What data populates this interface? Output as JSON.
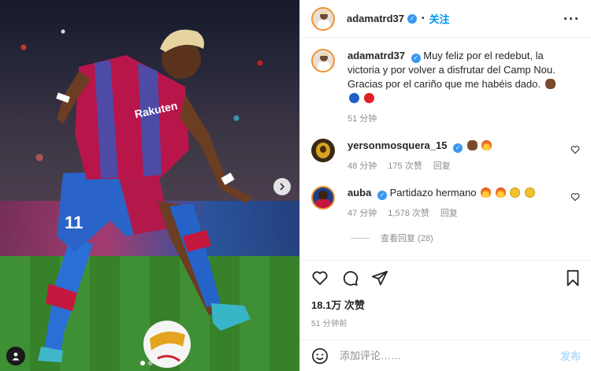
{
  "post": {
    "username": "adamatrd37",
    "follow_label": "关注",
    "separator": "•",
    "more_icon": "more-icon"
  },
  "caption": {
    "username": "adamatrd37",
    "text": "Muy feliz por el redebut, la victoria y por volver a disfrutar del Camp Nou. Gracias por el cariño que me habéis dado.",
    "time": "51 分钟"
  },
  "comments": [
    {
      "username": "yersonmosquera_15",
      "text": "",
      "time": "48 分钟",
      "likes": "175 次赞",
      "reply_label": "回复"
    },
    {
      "username": "auba",
      "text": "Partidazo hermano",
      "time": "47 分钟",
      "likes": "1,578 次赞",
      "reply_label": "回复"
    }
  ],
  "view_replies": "查看回复 (28)",
  "likes_total": "18.1万 次赞",
  "posted_ago": "51 分钟前",
  "comment_input": {
    "placeholder": "添加评论……",
    "submit_label": "发布"
  },
  "media": {
    "jersey_number": "11",
    "sponsor": "Rakuten",
    "carousel_index": 1,
    "carousel_count": 3
  },
  "colors": {
    "accent": "#0095f6",
    "verified": "#3897f0",
    "muted": "#8e8e8e",
    "post_disabled": "#b3dbff"
  }
}
